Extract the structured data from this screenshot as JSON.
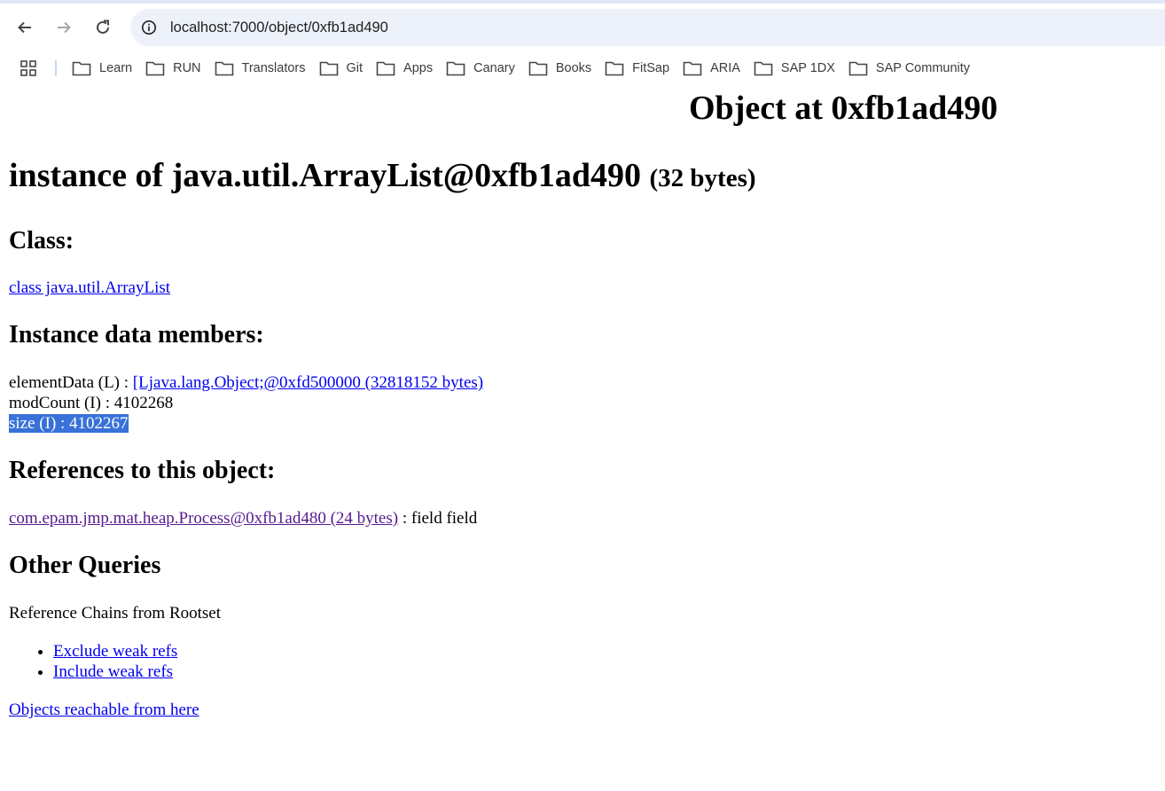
{
  "browser": {
    "url": "localhost:7000/object/0xfb1ad490",
    "bookmarks": [
      "Learn",
      "RUN",
      "Translators",
      "Git",
      "Apps",
      "Canary",
      "Books",
      "FitSap",
      "ARIA",
      "SAP 1DX",
      "SAP Community"
    ]
  },
  "page": {
    "title": "Object at 0xfb1ad490",
    "instance_heading": "instance of java.util.ArrayList@0xfb1ad490",
    "instance_size": "(32 bytes)",
    "class_heading": "Class:",
    "class_link": "class java.util.ArrayList",
    "members_heading": "Instance data members:",
    "members": {
      "element_data_label": "elementData (L) : ",
      "element_data_link": "[Ljava.lang.Object;@0xfd500000 (32818152 bytes)",
      "mod_count": "modCount (I) : 4102268",
      "size": "size (I) : 4102267"
    },
    "references_heading": "References to this object:",
    "reference_link": "com.epam.jmp.mat.heap.Process@0xfb1ad480 (24 bytes)",
    "reference_suffix": " : field field",
    "other_heading": "Other Queries",
    "chains_label": "Reference Chains from Rootset",
    "chain_links": [
      "Exclude weak refs",
      "Include weak refs"
    ],
    "reachable_link": "Objects reachable from here"
  },
  "colors": {
    "link": "#0000ee",
    "visited_link": "#551a8b",
    "selection": "#3871d8",
    "omnibox": "#edf2fa"
  }
}
